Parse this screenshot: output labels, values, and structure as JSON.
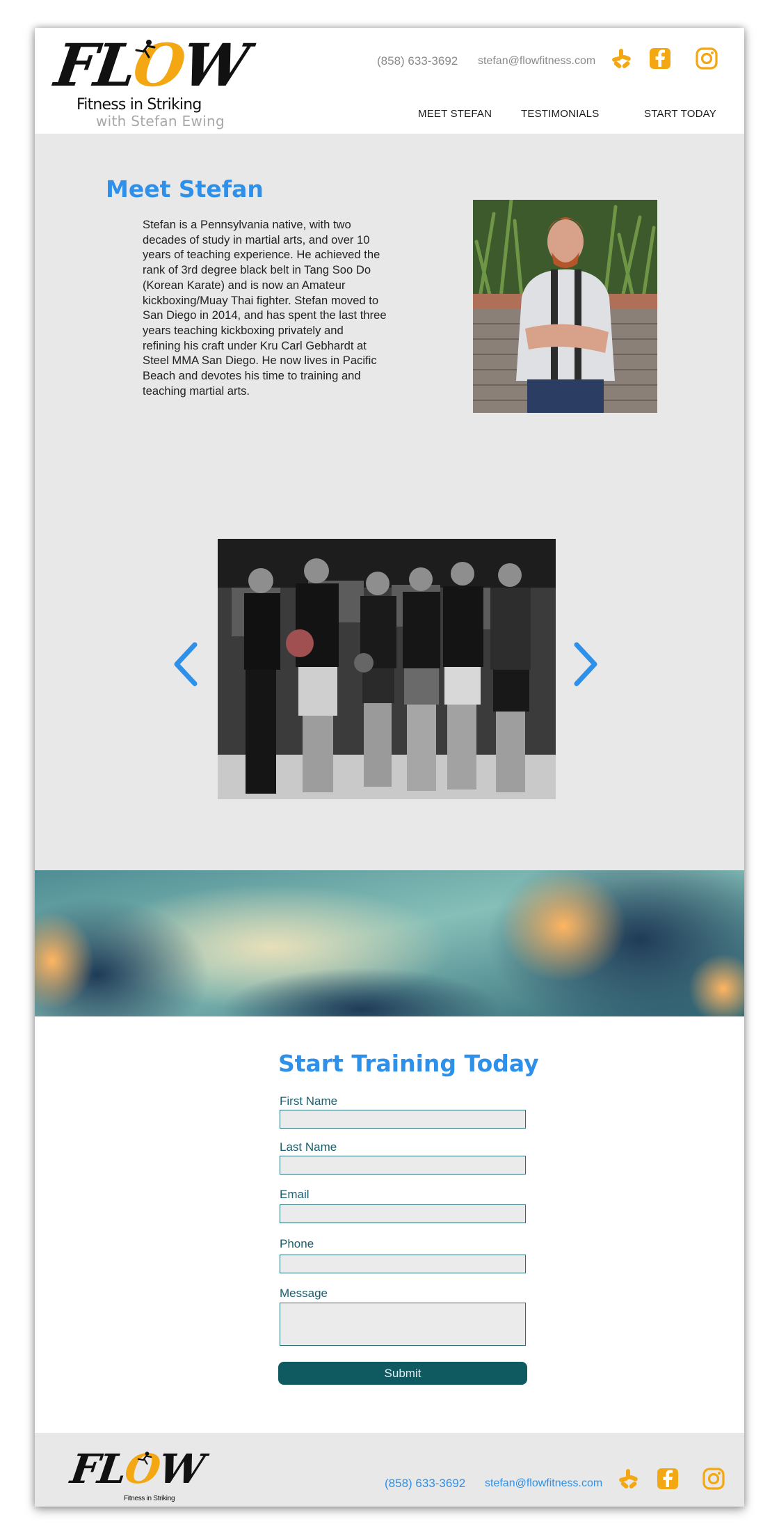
{
  "brand": {
    "name": "Flow",
    "tagline": "Fitness in Striking",
    "subtitle": "with Stefan Ewing",
    "accent_color": "#f3a712"
  },
  "header": {
    "phone": "(858) 633-3692",
    "email": "stefan@flowfitness.com",
    "social_icons": [
      "yelp-icon",
      "facebook-icon",
      "instagram-icon"
    ],
    "nav": [
      "MEET STEFAN",
      "TESTIMONIALS",
      "START TODAY"
    ]
  },
  "about": {
    "title": "Meet Stefan",
    "bio_lines": [
      "Stefan is a Pennsylvania native, with two",
      "decades of study in martial arts, and over 10",
      "years of teaching experience. He achieved the",
      "rank of 3rd degree black belt in Tang Soo Do",
      "(Korean Karate) and  is now an Amateur",
      "kickboxing/Muay Thai fighter. Stefan moved to",
      "San Diego in 2014, and has spent the last three",
      "years teaching kickboxing privately and",
      "refining his craft under Kru Carl Gebhardt at",
      "Steel MMA San Diego. He now lives in Pacific",
      "Beach and devotes his time to training and",
      "teaching martial arts."
    ],
    "title_color": "#2e90e8"
  },
  "form": {
    "title": "Start Training Today",
    "first_name_label": "First Name",
    "last_name_label": "Last Name",
    "email_label": "Email",
    "phone_label": "Phone",
    "message_label": "Message",
    "first_name_value": "",
    "last_name_value": "",
    "email_value": "",
    "phone_value": "",
    "message_value": "",
    "submit_label": "Submit",
    "button_color": "#0f5961"
  },
  "footer": {
    "brand_name": "Flow",
    "brand_tagline": "Fitness in Striking",
    "phone": "(858) 633-3692",
    "email": "stefan@flowfitness.com"
  }
}
